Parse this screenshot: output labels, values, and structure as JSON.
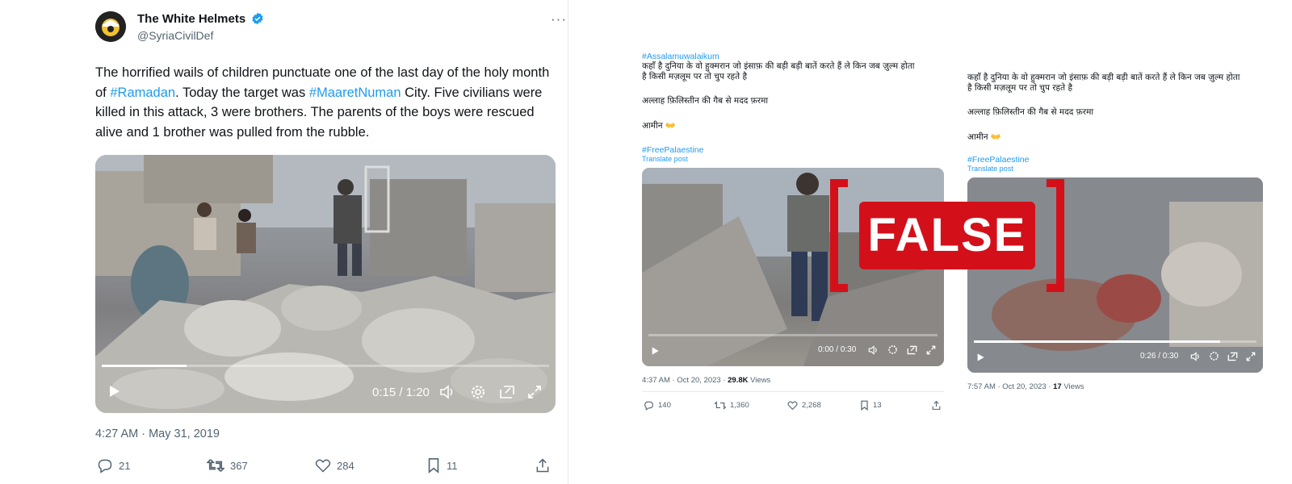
{
  "left_tweet": {
    "author": "The White Helmets",
    "handle": "@SyriaCivilDef",
    "text_parts": [
      "The horrified wails of children punctuate one of the last day of the holy month of ",
      "#Ramadan",
      ". Today the target was ",
      "#MaaretNuman",
      " City. Five civilians were killed in this attack, 3 were brothers. The parents of the boys were rescued alive and 1 brother was pulled from the rubble."
    ],
    "video_time": "0:15 / 1:20",
    "video_progress": 0.19,
    "timestamp": "4:27 AM · May 31, 2019",
    "replies": "21",
    "reposts": "367",
    "likes": "284",
    "bookmarks": "11"
  },
  "middle_tweet": {
    "hashtag_top": "#Assalamuwalaikum",
    "line1": "कहाँ है दुनिया के वो हुक्मरान जो इंसाफ़ की बड़ी बड़ी बातें करते हैं ले किन जब ज़ुल्म होता",
    "line2": "है किसी मज़लूम पर तो चुप रहते है",
    "line3": "अल्लाह फ़िलिस्तीन की गैब से मदद फ़रमा",
    "line4": "आमीन 👐",
    "hashtag_bottom": "#FreePalaestine",
    "translate": "Translate post",
    "video_time": "0:00 / 0:30",
    "video_progress": 0.0,
    "timestamp": "4:37 AM · Oct 20, 2023 · ",
    "views_count": "29.8K",
    "views_label": " Views",
    "replies": "140",
    "reposts": "1,360",
    "likes": "2,268",
    "bookmarks": "13"
  },
  "right_tweet": {
    "line1": "कहाँ है दुनिया के वो हुक्मरान जो इंसाफ़ की बड़ी बड़ी बातें करते हैं ले किन जब ज़ुल्म होता",
    "line2": "है किसी मज़लूम पर तो चुप रहते है",
    "line3": "अल्लाह फ़िलिस्तीन की गैब से मदद फ़रमा",
    "line4": "आमीन 👐",
    "hashtag_bottom": "#FreePalaestine",
    "translate": "Translate post",
    "video_time": "0:26 / 0:30",
    "video_progress": 0.87,
    "timestamp": "7:57 AM · Oct 20, 2023 · ",
    "views_count": "17",
    "views_label": " Views"
  },
  "stamp": {
    "label": "FALSE",
    "color": "#d3101a"
  },
  "colors": {
    "link": "#1d9bf0",
    "verified": "#1d9bf0",
    "muted": "#536471"
  }
}
